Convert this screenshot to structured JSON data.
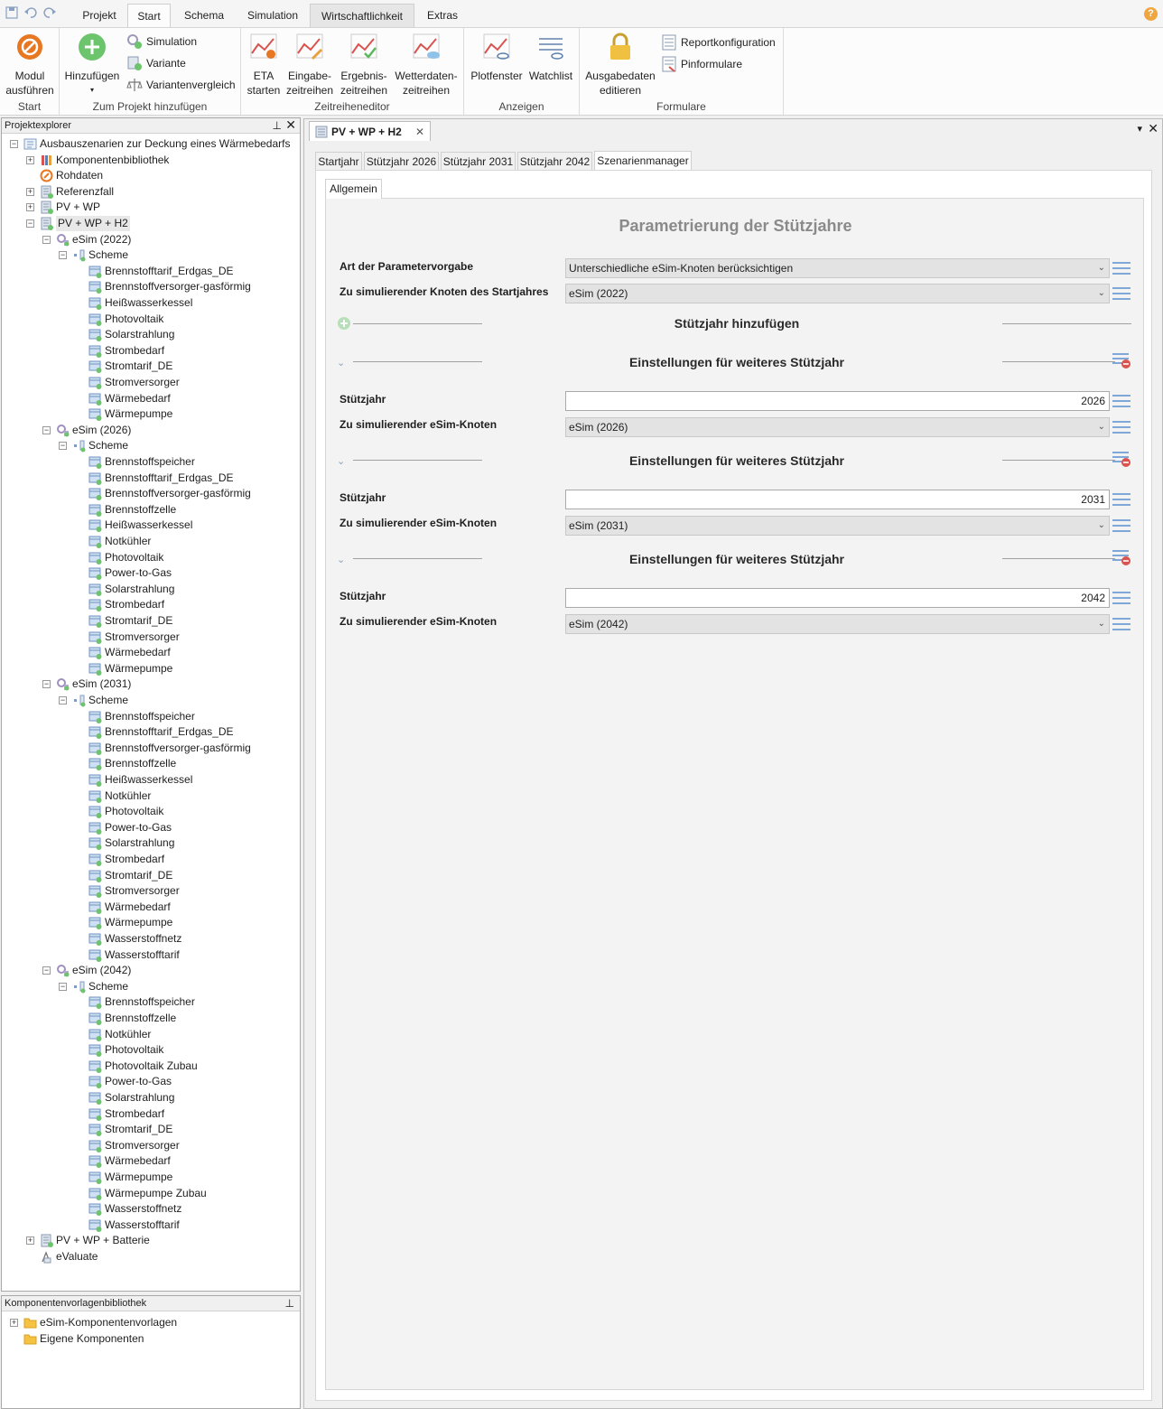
{
  "menu": {
    "tabs": [
      "Projekt",
      "Start",
      "Schema",
      "Simulation",
      "Wirtschaftlichkeit",
      "Extras"
    ],
    "help": "?"
  },
  "ribbon": {
    "start": {
      "label": "Start",
      "modul": "Modul\nausführen"
    },
    "add": {
      "label": "Zum Projekt hinzufügen",
      "hinzufuegen": "Hinzufügen",
      "simulation": "Simulation",
      "variante": "Variante",
      "variantenvergleich": "Variantenvergleich"
    },
    "zeitreihen": {
      "label": "Zeitreiheneditor",
      "eta": "ETA\nstarten",
      "eingabe": "Eingabe-\nzeitreihen",
      "ergebnis": "Ergebnis-\nzeitreihen",
      "wetter": "Wetterdaten-\nzeitreihen"
    },
    "anzeigen": {
      "label": "Anzeigen",
      "plot": "Plotfenster",
      "watch": "Watchlist"
    },
    "formulare": {
      "label": "Formulare",
      "ausgabe": "Ausgabedaten\neditieren",
      "report": "Reportkonfiguration",
      "pin": "Pinformulare"
    }
  },
  "explorer": {
    "title": "Projektexplorer",
    "tree": [
      {
        "label": "Ausbauszenarien zur Deckung eines Wärmebedarfs",
        "depth": 0,
        "exp": "-",
        "icon": "project"
      },
      {
        "label": "Komponentenbibliothek",
        "depth": 1,
        "exp": "+",
        "icon": "library"
      },
      {
        "label": "Rohdaten",
        "depth": 1,
        "exp": "",
        "icon": "raw"
      },
      {
        "label": "Referenzfall",
        "depth": 1,
        "exp": "+",
        "icon": "variant"
      },
      {
        "label": "PV + WP",
        "depth": 1,
        "exp": "+",
        "icon": "variant"
      },
      {
        "label": "PV + WP + H2",
        "depth": 1,
        "exp": "-",
        "icon": "variant",
        "selected": true
      },
      {
        "label": "eSim (2022)",
        "depth": 2,
        "exp": "-",
        "icon": "esim"
      },
      {
        "label": "Scheme",
        "depth": 3,
        "exp": "-",
        "icon": "scheme"
      },
      {
        "label": "Brennstofftarif_Erdgas_DE",
        "depth": 4,
        "icon": "comp"
      },
      {
        "label": "Brennstoffversorger-gasförmig",
        "depth": 4,
        "icon": "comp"
      },
      {
        "label": "Heißwasserkessel",
        "depth": 4,
        "icon": "comp"
      },
      {
        "label": "Photovoltaik",
        "depth": 4,
        "icon": "comp"
      },
      {
        "label": "Solarstrahlung",
        "depth": 4,
        "icon": "comp"
      },
      {
        "label": "Strombedarf",
        "depth": 4,
        "icon": "comp"
      },
      {
        "label": "Stromtarif_DE",
        "depth": 4,
        "icon": "comp"
      },
      {
        "label": "Stromversorger",
        "depth": 4,
        "icon": "comp"
      },
      {
        "label": "Wärmebedarf",
        "depth": 4,
        "icon": "comp"
      },
      {
        "label": "Wärmepumpe",
        "depth": 4,
        "icon": "comp"
      },
      {
        "label": "eSim (2026)",
        "depth": 2,
        "exp": "-",
        "icon": "esim"
      },
      {
        "label": "Scheme",
        "depth": 3,
        "exp": "-",
        "icon": "scheme"
      },
      {
        "label": "Brennstoffspeicher",
        "depth": 4,
        "icon": "comp"
      },
      {
        "label": "Brennstofftarif_Erdgas_DE",
        "depth": 4,
        "icon": "comp"
      },
      {
        "label": "Brennstoffversorger-gasförmig",
        "depth": 4,
        "icon": "comp"
      },
      {
        "label": "Brennstoffzelle",
        "depth": 4,
        "icon": "comp"
      },
      {
        "label": "Heißwasserkessel",
        "depth": 4,
        "icon": "comp"
      },
      {
        "label": "Notkühler",
        "depth": 4,
        "icon": "comp"
      },
      {
        "label": "Photovoltaik",
        "depth": 4,
        "icon": "comp"
      },
      {
        "label": "Power-to-Gas",
        "depth": 4,
        "icon": "comp"
      },
      {
        "label": "Solarstrahlung",
        "depth": 4,
        "icon": "comp"
      },
      {
        "label": "Strombedarf",
        "depth": 4,
        "icon": "comp"
      },
      {
        "label": "Stromtarif_DE",
        "depth": 4,
        "icon": "comp"
      },
      {
        "label": "Stromversorger",
        "depth": 4,
        "icon": "comp"
      },
      {
        "label": "Wärmebedarf",
        "depth": 4,
        "icon": "comp"
      },
      {
        "label": "Wärmepumpe",
        "depth": 4,
        "icon": "comp"
      },
      {
        "label": "eSim (2031)",
        "depth": 2,
        "exp": "-",
        "icon": "esim"
      },
      {
        "label": "Scheme",
        "depth": 3,
        "exp": "-",
        "icon": "scheme"
      },
      {
        "label": "Brennstoffspeicher",
        "depth": 4,
        "icon": "comp"
      },
      {
        "label": "Brennstofftarif_Erdgas_DE",
        "depth": 4,
        "icon": "comp"
      },
      {
        "label": "Brennstoffversorger-gasförmig",
        "depth": 4,
        "icon": "comp"
      },
      {
        "label": "Brennstoffzelle",
        "depth": 4,
        "icon": "comp"
      },
      {
        "label": "Heißwasserkessel",
        "depth": 4,
        "icon": "comp"
      },
      {
        "label": "Notkühler",
        "depth": 4,
        "icon": "comp"
      },
      {
        "label": "Photovoltaik",
        "depth": 4,
        "icon": "comp"
      },
      {
        "label": "Power-to-Gas",
        "depth": 4,
        "icon": "comp"
      },
      {
        "label": "Solarstrahlung",
        "depth": 4,
        "icon": "comp"
      },
      {
        "label": "Strombedarf",
        "depth": 4,
        "icon": "comp"
      },
      {
        "label": "Stromtarif_DE",
        "depth": 4,
        "icon": "comp"
      },
      {
        "label": "Stromversorger",
        "depth": 4,
        "icon": "comp"
      },
      {
        "label": "Wärmebedarf",
        "depth": 4,
        "icon": "comp"
      },
      {
        "label": "Wärmepumpe",
        "depth": 4,
        "icon": "comp"
      },
      {
        "label": "Wasserstoffnetz",
        "depth": 4,
        "icon": "comp"
      },
      {
        "label": "Wasserstofftarif",
        "depth": 4,
        "icon": "comp"
      },
      {
        "label": "eSim (2042)",
        "depth": 2,
        "exp": "-",
        "icon": "esim"
      },
      {
        "label": "Scheme",
        "depth": 3,
        "exp": "-",
        "icon": "scheme"
      },
      {
        "label": "Brennstoffspeicher",
        "depth": 4,
        "icon": "comp"
      },
      {
        "label": "Brennstoffzelle",
        "depth": 4,
        "icon": "comp"
      },
      {
        "label": "Notkühler",
        "depth": 4,
        "icon": "comp"
      },
      {
        "label": "Photovoltaik",
        "depth": 4,
        "icon": "comp"
      },
      {
        "label": "Photovoltaik Zubau",
        "depth": 4,
        "icon": "comp"
      },
      {
        "label": "Power-to-Gas",
        "depth": 4,
        "icon": "comp"
      },
      {
        "label": "Solarstrahlung",
        "depth": 4,
        "icon": "comp"
      },
      {
        "label": "Strombedarf",
        "depth": 4,
        "icon": "comp"
      },
      {
        "label": "Stromtarif_DE",
        "depth": 4,
        "icon": "comp"
      },
      {
        "label": "Stromversorger",
        "depth": 4,
        "icon": "comp"
      },
      {
        "label": "Wärmebedarf",
        "depth": 4,
        "icon": "comp"
      },
      {
        "label": "Wärmepumpe",
        "depth": 4,
        "icon": "comp"
      },
      {
        "label": "Wärmepumpe Zubau",
        "depth": 4,
        "icon": "comp"
      },
      {
        "label": "Wasserstoffnetz",
        "depth": 4,
        "icon": "comp"
      },
      {
        "label": "Wasserstofftarif",
        "depth": 4,
        "icon": "comp"
      },
      {
        "label": "PV + WP + Batterie",
        "depth": 1,
        "exp": "+",
        "icon": "variant"
      },
      {
        "label": "eValuate",
        "depth": 1,
        "exp": "",
        "icon": "evaluate"
      }
    ]
  },
  "library": {
    "title": "Komponentenvorlagenbibliothek",
    "items": [
      {
        "label": "eSim-Komponentenvorlagen",
        "exp": "+"
      },
      {
        "label": "Eigene Komponenten",
        "exp": ""
      }
    ]
  },
  "document": {
    "tab": "PV + WP + H2",
    "subtabs": [
      "Startjahr",
      "Stützjahr 2026",
      "Stützjahr 2031",
      "Stützjahr 2042",
      "Szenarienmanager"
    ],
    "inner_tab": "Allgemein",
    "heading": "Parametrierung der Stützjahre",
    "art_label": "Art der Parametervorgabe",
    "art_value": "Unterschiedliche eSim-Knoten berücksichtigen",
    "knoten_start_label": "Zu simulierender Knoten des Startjahres",
    "knoten_start_value": "eSim (2022)",
    "add_section": "Stützjahr hinzufügen",
    "sections": [
      {
        "title": "Einstellungen für weiteres Stützjahr",
        "year_label": "Stützjahr",
        "year": "2026",
        "node_label": "Zu simulierender eSim-Knoten",
        "node": "eSim (2026)"
      },
      {
        "title": "Einstellungen für weiteres Stützjahr",
        "year_label": "Stützjahr",
        "year": "2031",
        "node_label": "Zu simulierender eSim-Knoten",
        "node": "eSim (2031)"
      },
      {
        "title": "Einstellungen für weiteres Stützjahr",
        "year_label": "Stützjahr",
        "year": "2042",
        "node_label": "Zu simulierender eSim-Knoten",
        "node": "eSim (2042)"
      }
    ]
  },
  "colors": {
    "accent": "#e87722",
    "green": "#5cb85c",
    "red": "#d9534f",
    "blue_lines": "#7fa8d8",
    "heading_gray": "#8a8a8a"
  }
}
